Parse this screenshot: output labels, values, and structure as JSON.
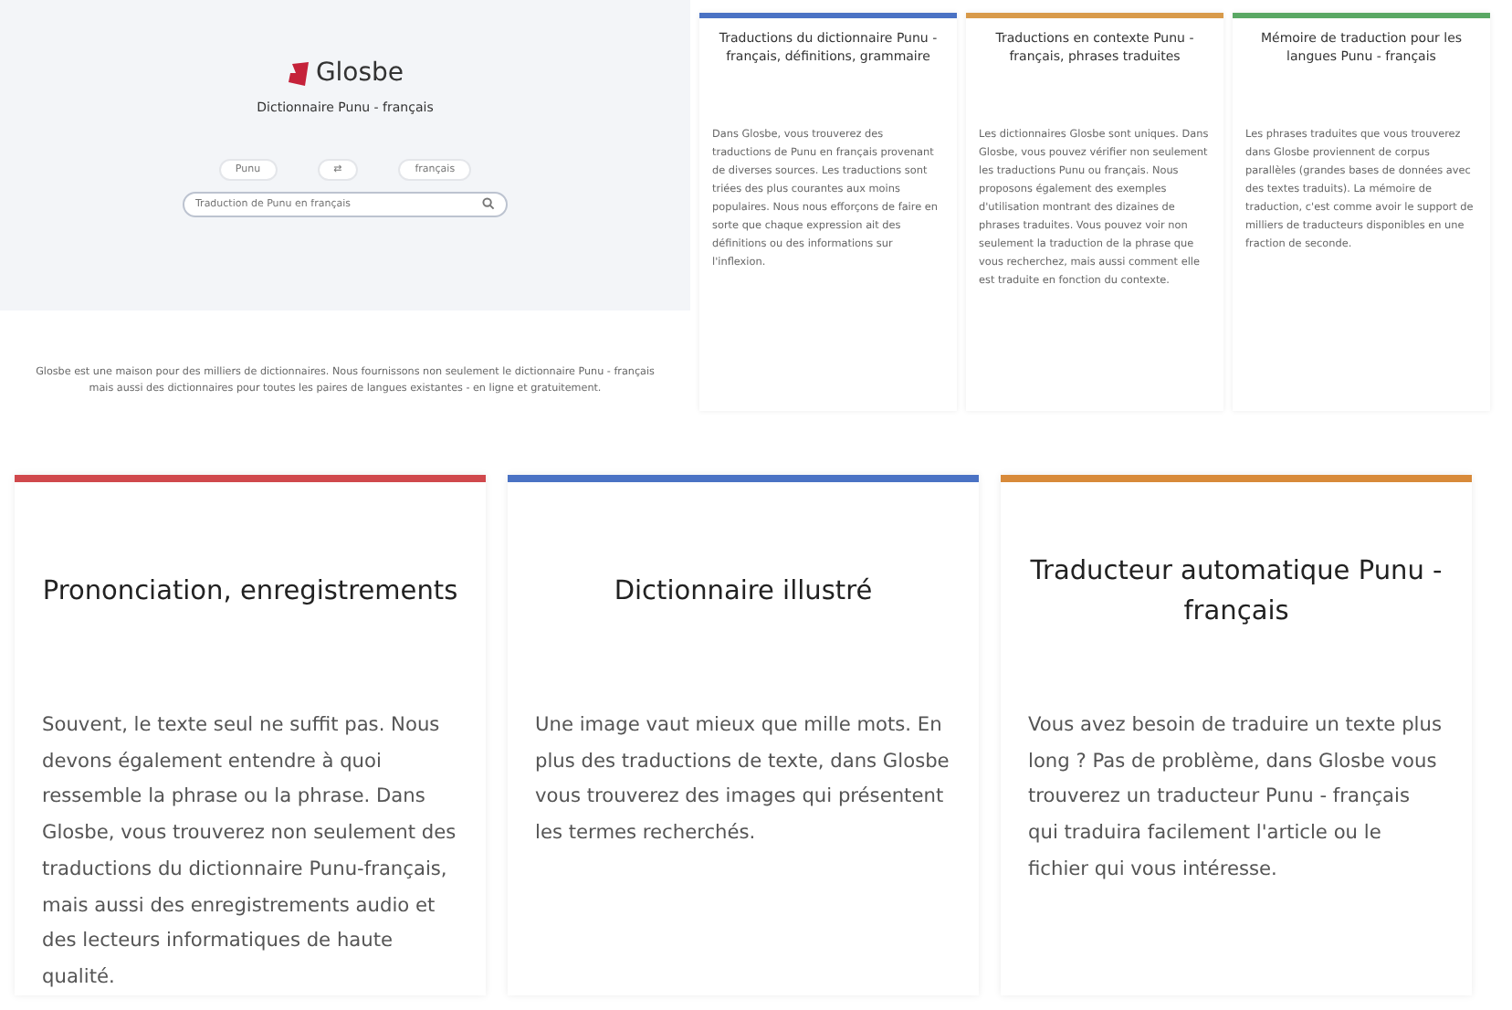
{
  "hero": {
    "logo": "Glosbe",
    "subtitle": "Dictionnaire Punu - français",
    "source_language": "Punu",
    "swap": "⇄",
    "target_language": "français",
    "search": {
      "placeholder": "Traduction de Punu en français"
    },
    "description": "Glosbe est une maison pour des milliers de dictionnaires. Nous fournissons non seulement le dictionnaire Punu - français mais aussi des dictionnaires pour toutes les paires de langues existantes - en ligne et gratuitement."
  },
  "feature_cards": [
    {
      "title": "Traductions du dictionnaire Punu - français, définitions, grammaire",
      "body": "Dans Glosbe, vous trouverez des traductions de Punu en français provenant de diverses sources. Les traductions sont triées des plus courantes aux moins populaires. Nous nous efforçons de faire en sorte que chaque expression ait des définitions ou des informations sur l'inflexion.",
      "color": "#4a72c4"
    },
    {
      "title": "Traductions en contexte Punu - français, phrases traduites",
      "body": "Les dictionnaires Glosbe sont uniques. Dans Glosbe, vous pouvez vérifier non seulement les traductions Punu ou français. Nous proposons également des exemples d'utilisation montrant des dizaines de phrases traduites. Vous pouvez voir non seulement la traduction de la phrase que vous recherchez, mais aussi comment elle est traduite en fonction du contexte.",
      "color": "#d89a4a"
    },
    {
      "title": "Mémoire de traduction pour les langues Punu - français",
      "body": "Les phrases traduites que vous trouverez dans Glosbe proviennent de corpus parallèles (grandes bases de données avec des textes traduits). La mémoire de traduction, c'est comme avoir le support de milliers de traducteurs disponibles en une fraction de seconde.",
      "color": "#5aa864"
    }
  ],
  "info_cards": [
    {
      "title": "Prononciation, enregistrements",
      "body": "Souvent, le texte seul ne suffit pas. Nous devons également entendre à quoi ressemble la phrase ou la phrase. Dans Glosbe, vous trouverez non seulement des traductions du dictionnaire Punu-français, mais aussi des enregistrements audio et des lecteurs informatiques de haute qualité.",
      "color": "#d0484c"
    },
    {
      "title": "Dictionnaire illustré",
      "body": "Une image vaut mieux que mille mots. En plus des traductions de texte, dans Glosbe vous trouverez des images qui présentent les termes recherchés.",
      "color": "#4a72c4"
    },
    {
      "title": "Traducteur automatique Punu - français",
      "body": "Vous avez besoin de traduire un texte plus long ? Pas de problème, dans Glosbe vous trouverez un traducteur Punu - français qui traduira facilement l'article ou le fichier qui vous intéresse.",
      "color": "#d88a3a"
    }
  ]
}
